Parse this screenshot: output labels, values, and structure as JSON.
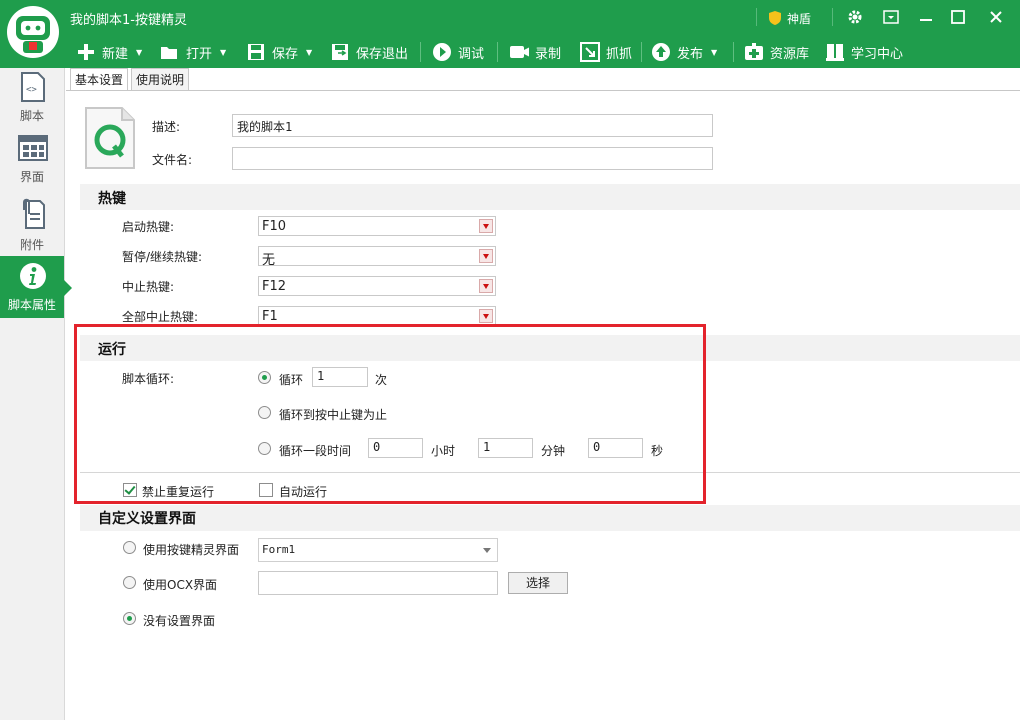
{
  "window": {
    "title": "我的脚本1-按键精灵",
    "badge_label": "神盾"
  },
  "toolbar": [
    {
      "label": "新建",
      "icon": "plus-icon",
      "dropdown": true
    },
    {
      "label": "打开",
      "icon": "folder-open-icon",
      "dropdown": true
    },
    {
      "label": "保存",
      "icon": "save-icon",
      "dropdown": true
    },
    {
      "label": "保存退出",
      "icon": "save-exit-icon",
      "dropdown": false
    },
    {
      "label": "调试",
      "icon": "play-icon",
      "dropdown": false
    },
    {
      "label": "录制",
      "icon": "camera-icon",
      "dropdown": false
    },
    {
      "label": "抓抓",
      "icon": "grab-icon",
      "dropdown": false
    },
    {
      "label": "发布",
      "icon": "publish-icon",
      "dropdown": true
    },
    {
      "label": "资源库",
      "icon": "resource-icon",
      "dropdown": false
    },
    {
      "label": "学习中心",
      "icon": "learn-icon",
      "dropdown": false
    }
  ],
  "sidebar": [
    {
      "label": "脚本",
      "icon": "script-icon"
    },
    {
      "label": "界面",
      "icon": "ui-grid-icon"
    },
    {
      "label": "附件",
      "icon": "attachment-icon"
    },
    {
      "label": "脚本属性",
      "icon": "info-icon"
    }
  ],
  "tabs": [
    "基本设置",
    "使用说明"
  ],
  "basic": {
    "desc_label": "描述:",
    "desc_value": "我的脚本1",
    "filename_label": "文件名:",
    "filename_value": ""
  },
  "hotkeys": {
    "title": "热键",
    "items": [
      {
        "label": "启动热键:",
        "value": "F10"
      },
      {
        "label": "暂停/继续热键:",
        "value": "无"
      },
      {
        "label": "中止热键:",
        "value": "F12"
      },
      {
        "label": "全部中止热键:",
        "value": "F1"
      }
    ]
  },
  "run": {
    "title": "运行",
    "loop_label": "脚本循环:",
    "opt_loop": "循环",
    "loop_count": "1",
    "loop_unit": "次",
    "opt_until_stop": "循环到按中止键为止",
    "opt_duration": "循环一段时间",
    "hours": "0",
    "hours_unit": "小时",
    "minutes": "1",
    "minutes_unit": "分钟",
    "seconds": "0",
    "seconds_unit": "秒",
    "selected": "loop",
    "no_repeat_label": "禁止重复运行",
    "no_repeat_checked": true,
    "auto_run_label": "自动运行",
    "auto_run_checked": false
  },
  "custom_ui": {
    "title": "自定义设置界面",
    "opt_qmacro": "使用按键精灵界面",
    "form_value": "Form1",
    "opt_ocx": "使用OCX界面",
    "ocx_value": "",
    "select_button": "选择",
    "opt_none": "没有设置界面",
    "selected": "none"
  },
  "colors": {
    "brand_green": "#1f9d4c",
    "highlight_red": "#e3232c"
  }
}
